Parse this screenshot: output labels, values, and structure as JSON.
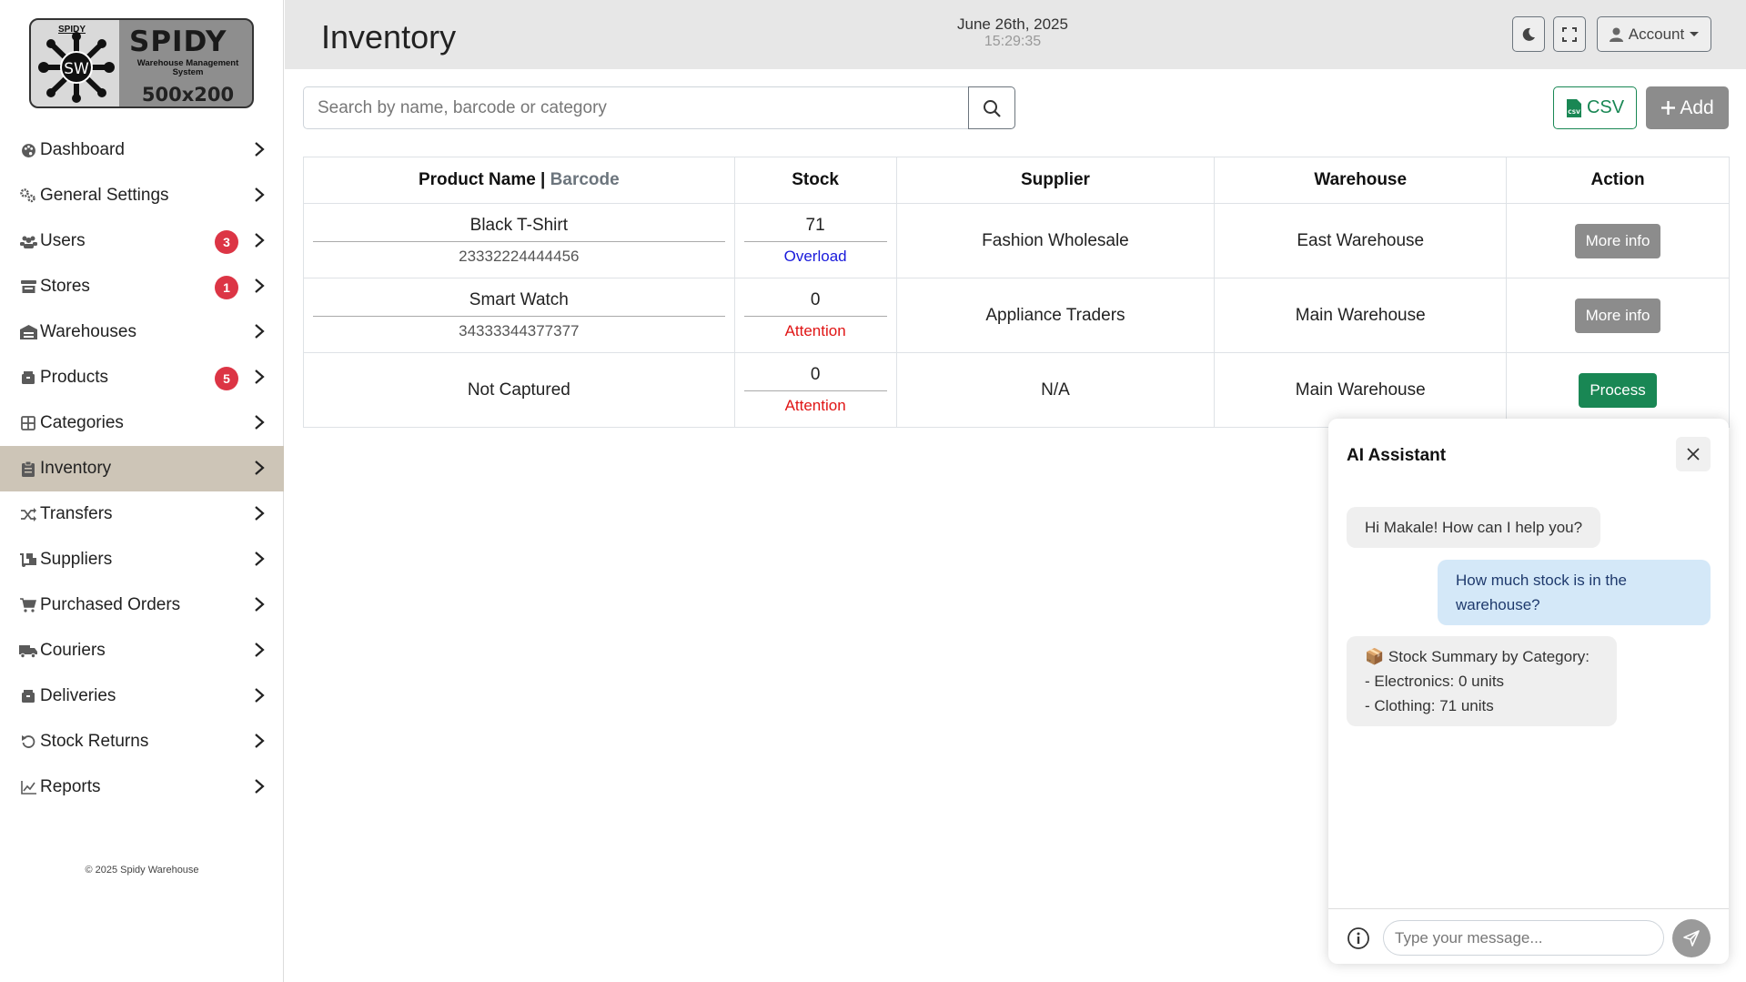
{
  "brand": {
    "logo_small": "SPIDY",
    "logo_title": "SPIDY",
    "logo_subtitle": "Warehouse Management System",
    "logo_size": "500x200",
    "logo_initials": "SW"
  },
  "sidebar": {
    "items": [
      {
        "label": "Dashboard",
        "icon": "palette-icon",
        "badge": null,
        "active": false
      },
      {
        "label": "General Settings",
        "icon": "gears-icon",
        "badge": null,
        "active": false
      },
      {
        "label": "Users",
        "icon": "users-icon",
        "badge": "3",
        "active": false
      },
      {
        "label": "Stores",
        "icon": "store-icon",
        "badge": "1",
        "active": false
      },
      {
        "label": "Warehouses",
        "icon": "warehouse-icon",
        "badge": null,
        "active": false
      },
      {
        "label": "Products",
        "icon": "box-icon",
        "badge": "5",
        "active": false
      },
      {
        "label": "Categories",
        "icon": "grid-icon",
        "badge": null,
        "active": false
      },
      {
        "label": "Inventory",
        "icon": "clipboard-icon",
        "badge": null,
        "active": true
      },
      {
        "label": "Transfers",
        "icon": "shuffle-icon",
        "badge": null,
        "active": false
      },
      {
        "label": "Suppliers",
        "icon": "dolly-icon",
        "badge": null,
        "active": false
      },
      {
        "label": "Purchased Orders",
        "icon": "cart-icon",
        "badge": null,
        "active": false
      },
      {
        "label": "Couriers",
        "icon": "truck-icon",
        "badge": null,
        "active": false
      },
      {
        "label": "Deliveries",
        "icon": "box-icon",
        "badge": null,
        "active": false
      },
      {
        "label": "Stock Returns",
        "icon": "undo-icon",
        "badge": null,
        "active": false
      },
      {
        "label": "Reports",
        "icon": "chart-line-icon",
        "badge": null,
        "active": false
      }
    ],
    "footer": "© 2025 Spidy Warehouse"
  },
  "header": {
    "title": "Inventory",
    "date": "June 26th, 2025",
    "time": "15:29:35",
    "account_label": "Account"
  },
  "toolbar": {
    "search_placeholder": "Search by name, barcode or category",
    "csv_label": "CSV",
    "add_label": "Add"
  },
  "table": {
    "headers": {
      "product": "Product Name |",
      "barcode": "Barcode",
      "stock": "Stock",
      "supplier": "Supplier",
      "warehouse": "Warehouse",
      "action": "Action"
    },
    "rows": [
      {
        "product": "Black T-Shirt",
        "barcode": "23332224444456",
        "stock": "71",
        "stock_status": "Overload",
        "supplier": "Fashion Wholesale",
        "warehouse": "East Warehouse",
        "action": "More info"
      },
      {
        "product": "Smart Watch",
        "barcode": "34333344377377",
        "stock": "0",
        "stock_status": "Attention",
        "supplier": "Appliance Traders",
        "warehouse": "Main Warehouse",
        "action": "More info"
      },
      {
        "product": "Not Captured",
        "barcode": "",
        "stock": "0",
        "stock_status": "Attention",
        "supplier": "N/A",
        "warehouse": "Main Warehouse",
        "action": "Process"
      }
    ]
  },
  "ai_assistant": {
    "title": "AI Assistant",
    "messages": {
      "bot_greeting": "Hi Makale! How can I help you?",
      "user_question": "How much stock is in the warehouse?",
      "bot_summary_title": "📦 Stock Summary by Category:",
      "bot_summary_line1": "- Electronics: 0 units",
      "bot_summary_line2": "- Clothing: 71 units"
    },
    "input_placeholder": "Type your message..."
  },
  "colors": {
    "active_nav": "#cdc5b7",
    "badge": "#dc3545",
    "success": "#198754",
    "attention": "#e01515",
    "overload": "#1a1adb",
    "user_bubble": "#d4e8f8"
  }
}
